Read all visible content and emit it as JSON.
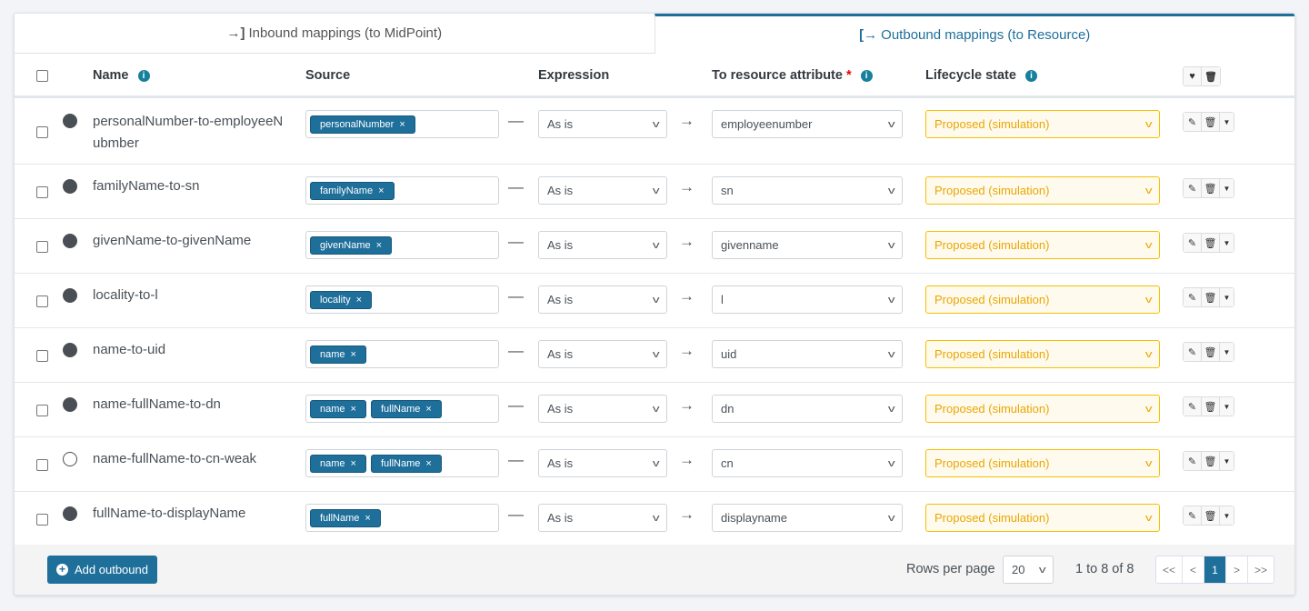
{
  "tabs": [
    {
      "label": "Inbound mappings (to MidPoint)",
      "icon": "sign-in-icon",
      "active": false
    },
    {
      "label": "Outbound mappings (to Resource)",
      "icon": "sign-out-icon",
      "active": true
    }
  ],
  "columns": {
    "name": "Name",
    "source": "Source",
    "expression": "Expression",
    "target": "To resource attribute",
    "required_mark": "*",
    "lifecycle": "Lifecycle state"
  },
  "rows": [
    {
      "name": "personalNumber-to-employeeNubmber",
      "sources": [
        "personalNumber"
      ],
      "expression": "As is",
      "target": "employeenumber",
      "lifecycle": "Proposed (simulation)",
      "strong": true
    },
    {
      "name": "familyName-to-sn",
      "sources": [
        "familyName"
      ],
      "expression": "As is",
      "target": "sn",
      "lifecycle": "Proposed (simulation)",
      "strong": true
    },
    {
      "name": "givenName-to-givenName",
      "sources": [
        "givenName"
      ],
      "expression": "As is",
      "target": "givenname",
      "lifecycle": "Proposed (simulation)",
      "strong": true
    },
    {
      "name": "locality-to-l",
      "sources": [
        "locality"
      ],
      "expression": "As is",
      "target": "l",
      "lifecycle": "Proposed (simulation)",
      "strong": true
    },
    {
      "name": "name-to-uid",
      "sources": [
        "name"
      ],
      "expression": "As is",
      "target": "uid",
      "lifecycle": "Proposed (simulation)",
      "strong": true
    },
    {
      "name": "name-fullName-to-dn",
      "sources": [
        "name",
        "fullName"
      ],
      "expression": "As is",
      "target": "dn",
      "lifecycle": "Proposed (simulation)",
      "strong": true
    },
    {
      "name": "name-fullName-to-cn-weak",
      "sources": [
        "name",
        "fullName"
      ],
      "expression": "As is",
      "target": "cn",
      "lifecycle": "Proposed (simulation)",
      "strong": false
    },
    {
      "name": "fullName-to-displayName",
      "sources": [
        "fullName"
      ],
      "expression": "As is",
      "target": "displayname",
      "lifecycle": "Proposed (simulation)",
      "strong": true
    }
  ],
  "footer": {
    "add_label": "Add outbound",
    "rows_per_page_label": "Rows per page",
    "rows_per_page": "20",
    "range": "1 to 8 of 8",
    "pages": [
      "<<",
      "<",
      "1",
      ">",
      ">>"
    ],
    "current_page": "1"
  },
  "colors": {
    "accent": "#1f6f9b",
    "lifecycle": "#e9a700"
  }
}
